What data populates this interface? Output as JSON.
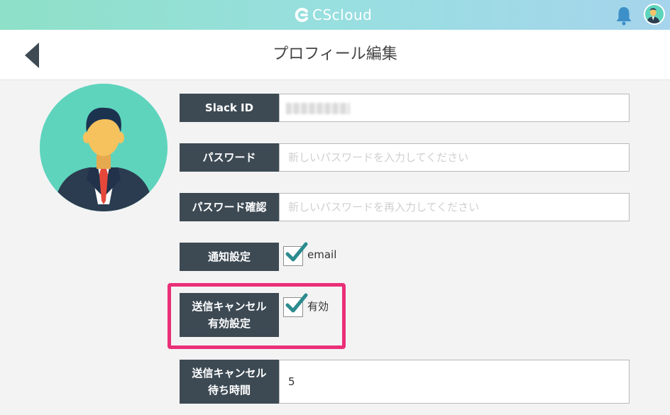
{
  "topbar": {
    "logo_text": "CScloud",
    "brand_color": "#8ee0c7",
    "bell_icon": "bell-icon",
    "avatar_icon": "user-avatar-icon"
  },
  "header": {
    "title": "プロフィール編集",
    "back_icon": "chevron-left-icon"
  },
  "form": {
    "slack_id": {
      "label": "Slack ID",
      "value": ""
    },
    "password": {
      "label": "パスワード",
      "placeholder": "新しいパスワードを入力してください"
    },
    "password_confirm": {
      "label": "パスワード確認",
      "placeholder": "新しいパスワードを再入力してください"
    },
    "notification": {
      "label": "通知設定",
      "option": "email",
      "checked": true
    },
    "send_cancel": {
      "label_line1": "送信キャンセル",
      "label_line2": "有効設定",
      "option": "有効",
      "checked": true
    },
    "cancel_wait": {
      "label_line1": "送信キャンセル",
      "label_line2": "待ち時間",
      "value": "5"
    }
  },
  "colors": {
    "label_bg": "#3d4a54",
    "check_color": "#2c8b8f",
    "highlight": "#ea2f78"
  }
}
